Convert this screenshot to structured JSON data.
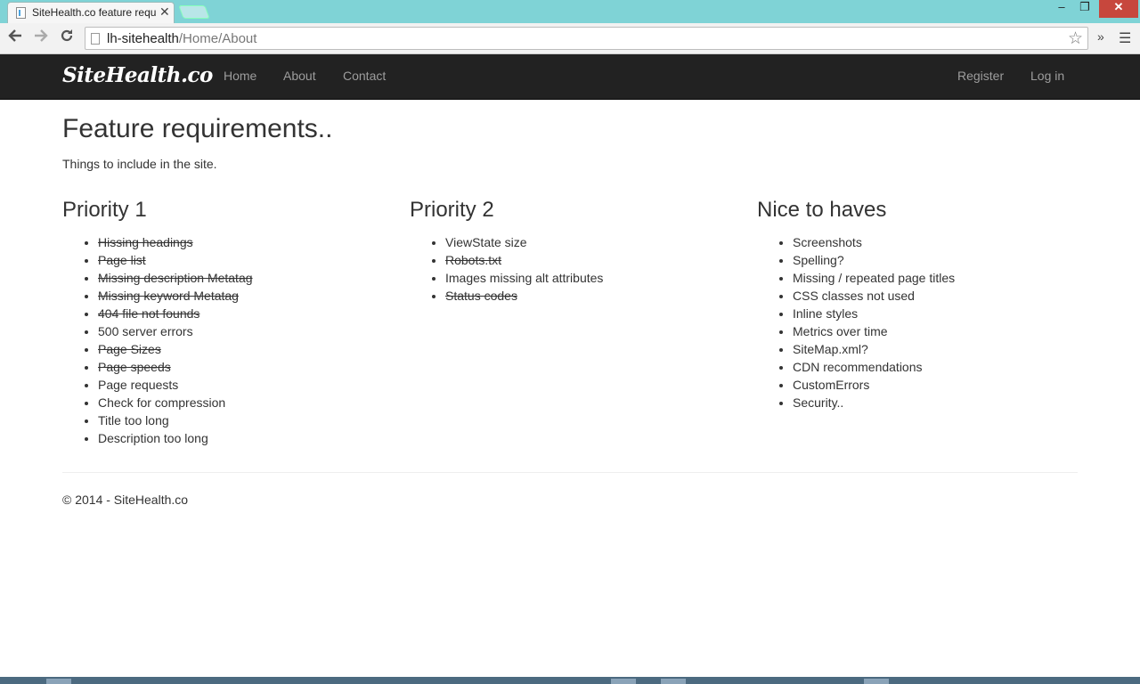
{
  "browser": {
    "tab_title": "SiteHealth.co feature requ",
    "tab_close": "✕",
    "url_host": "lh-sitehealth",
    "url_path": "/Home/About",
    "win_min": "‒",
    "win_max": "❐",
    "win_close": "✕"
  },
  "navbar": {
    "brand": "SiteHealth.co",
    "links": [
      "Home",
      "About",
      "Contact"
    ],
    "right_links": [
      "Register",
      "Log in"
    ]
  },
  "main": {
    "title": "Feature requirements..",
    "subtitle": "Things to include in the site."
  },
  "columns": [
    {
      "heading": "Priority 1",
      "items": [
        {
          "text": "Hissing headings",
          "done": true
        },
        {
          "text": "Page list",
          "done": true
        },
        {
          "text": "Missing description Metatag",
          "done": true
        },
        {
          "text": "Missing keyword Metatag",
          "done": true
        },
        {
          "text": "404 file not founds",
          "done": true
        },
        {
          "text": "500 server errors",
          "done": false
        },
        {
          "text": "Page Sizes",
          "done": true
        },
        {
          "text": "Page speeds",
          "done": true
        },
        {
          "text": "Page requests",
          "done": false
        },
        {
          "text": "Check for compression",
          "done": false
        },
        {
          "text": "Title too long",
          "done": false
        },
        {
          "text": "Description too long",
          "done": false
        }
      ]
    },
    {
      "heading": "Priority 2",
      "items": [
        {
          "text": "ViewState size",
          "done": false
        },
        {
          "text": "Robots.txt",
          "done": true
        },
        {
          "text": "Images missing alt attributes",
          "done": false
        },
        {
          "text": "Status codes",
          "done": true
        }
      ]
    },
    {
      "heading": "Nice to haves",
      "items": [
        {
          "text": "Screenshots",
          "done": false
        },
        {
          "text": "Spelling?",
          "done": false
        },
        {
          "text": "Missing / repeated page titles",
          "done": false
        },
        {
          "text": "CSS classes not used",
          "done": false
        },
        {
          "text": "Inline styles",
          "done": false
        },
        {
          "text": "Metrics over time",
          "done": false
        },
        {
          "text": "SiteMap.xml?",
          "done": false
        },
        {
          "text": "CDN recommendations",
          "done": false
        },
        {
          "text": "CustomErrors",
          "done": false
        },
        {
          "text": "Security..",
          "done": false
        }
      ]
    }
  ],
  "footer": {
    "text": "© 2014 - SiteHealth.co"
  }
}
